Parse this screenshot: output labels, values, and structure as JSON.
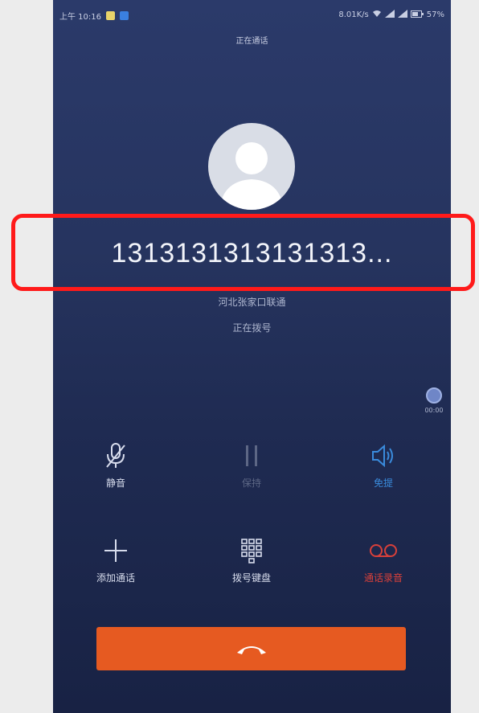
{
  "status_bar": {
    "time": "上午 10:16",
    "right_text": "8.01K/s",
    "battery": "57%"
  },
  "call_label": "正在通话",
  "phone_number": "1313131313131313...",
  "location": "河北张家口联通",
  "call_status": "正在拨号",
  "side_float_label": "00:00",
  "controls": {
    "mute": "静音",
    "hold": "保持",
    "speaker": "免提",
    "add_call": "添加通话",
    "keypad": "拨号键盘",
    "record": "通话录音"
  },
  "colors": {
    "background_top": "#2b3a6a",
    "background_bottom": "#182244",
    "end_call": "#e65a21",
    "speaker_active": "#3a8bdc",
    "record": "#d8403a",
    "highlight_box": "#ff1a1a"
  }
}
